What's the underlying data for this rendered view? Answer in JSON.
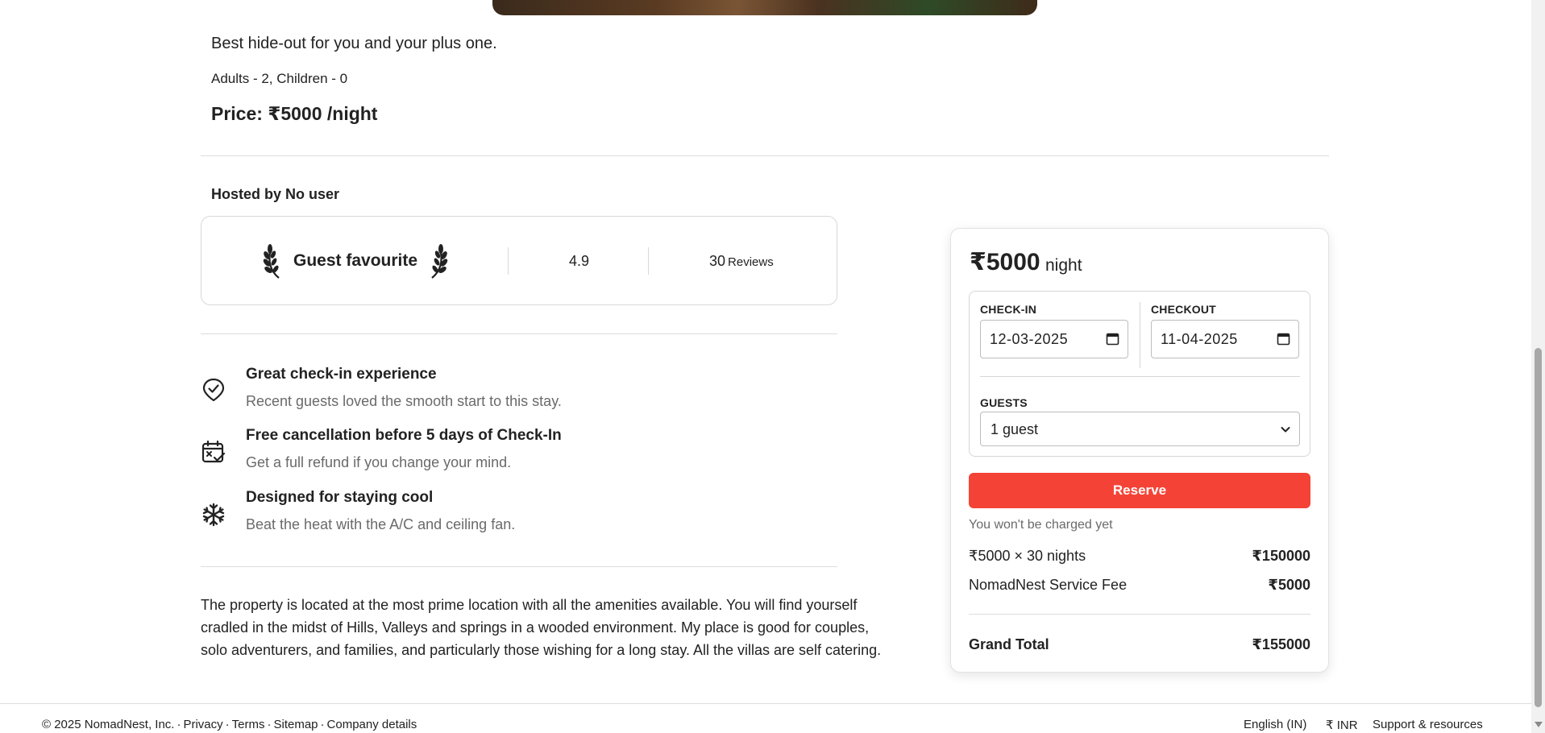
{
  "listing": {
    "headline": "Best hide-out for you and your plus one.",
    "occupancy": "Adults - 2, Children - 0",
    "price": "Price: ₹5000 /night",
    "host": "Hosted by No user"
  },
  "guest_card": {
    "badge": "Guest favourite",
    "rating": "4.9",
    "reviews_count": "30",
    "reviews_label": "Reviews"
  },
  "features": [
    {
      "icon": "check-badge-icon",
      "title": "Great check-in experience",
      "desc": "Recent guests loved the smooth start to this stay."
    },
    {
      "icon": "calendar-check-icon",
      "title": "Free cancellation before 5 days of Check-In",
      "desc": "Get a full refund if you change your mind."
    },
    {
      "icon": "snowflake-icon",
      "title": "Designed for staying cool",
      "desc": "Beat the heat with the A/C and ceiling fan."
    }
  ],
  "description": "The property is located at the most prime location with all the amenities available. You will find yourself cradled in the midst of Hills, Valleys and springs in a wooded environment. My place is good for couples, solo adventurers, and families, and particularly those wishing for a long stay. All the villas are self catering.",
  "booking": {
    "price": "₹5000",
    "price_unit": "night",
    "checkin_label": "CHECK-IN",
    "checkin_value": "12-03-2025",
    "checkout_label": "CHECKOUT",
    "checkout_value": "11-04-2025",
    "guests_label": "GUESTS",
    "guests_value": "1 guest",
    "reserve_label": "Reserve",
    "note": "You won't be charged yet",
    "nights_label": "₹5000 × 30 nights",
    "nights_value": "₹150000",
    "fee_label": "NomadNest Service Fee",
    "fee_value": "₹5000",
    "total_label": "Grand Total",
    "total_value": "₹155000",
    "accent_color": "#f44336"
  },
  "footer": {
    "copyright": "© 2025 NomadNest, Inc.",
    "links": [
      "Privacy",
      "Terms",
      "Sitemap",
      "Company details"
    ],
    "language": "English (IN)",
    "currency": "₹ INR",
    "support": "Support & resources"
  }
}
